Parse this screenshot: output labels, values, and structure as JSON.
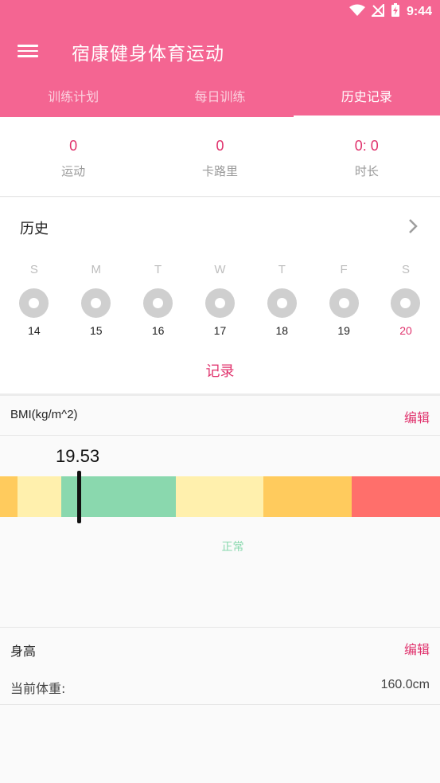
{
  "status_bar": {
    "time": "9:44"
  },
  "app_bar": {
    "title": "宿康健身体育运动"
  },
  "tabs": [
    {
      "label": "训练计划"
    },
    {
      "label": "每日训练"
    },
    {
      "label": "历史记录"
    }
  ],
  "stats": [
    {
      "value": "0",
      "label": "运动"
    },
    {
      "value": "0",
      "label": "卡路里"
    },
    {
      "value": "0: 0",
      "label": "时长"
    }
  ],
  "history": {
    "title": "历史",
    "days": [
      {
        "weekday": "S",
        "date": "14"
      },
      {
        "weekday": "M",
        "date": "15"
      },
      {
        "weekday": "T",
        "date": "16"
      },
      {
        "weekday": "W",
        "date": "17"
      },
      {
        "weekday": "T",
        "date": "18"
      },
      {
        "weekday": "F",
        "date": "19"
      },
      {
        "weekday": "S",
        "date": "20"
      }
    ],
    "record_label": "记录"
  },
  "bmi": {
    "title": "BMI(kg/m^2)",
    "edit_label": "编辑",
    "value": "19.53",
    "status": "正常",
    "colors": {
      "underweight_dark": "#ffcb5d",
      "underweight_light": "#fff0ad",
      "normal": "#8ad8ae",
      "overweight_light": "#fff0ad",
      "overweight": "#ffcb5d",
      "obese": "#ff6f6b"
    }
  },
  "body": {
    "height_title": "身高",
    "edit_label": "编辑",
    "weight_label": "当前体重:",
    "weight_value": "160.0cm"
  },
  "colors": {
    "accent": "#f46592",
    "accent_text": "#e0336d"
  }
}
